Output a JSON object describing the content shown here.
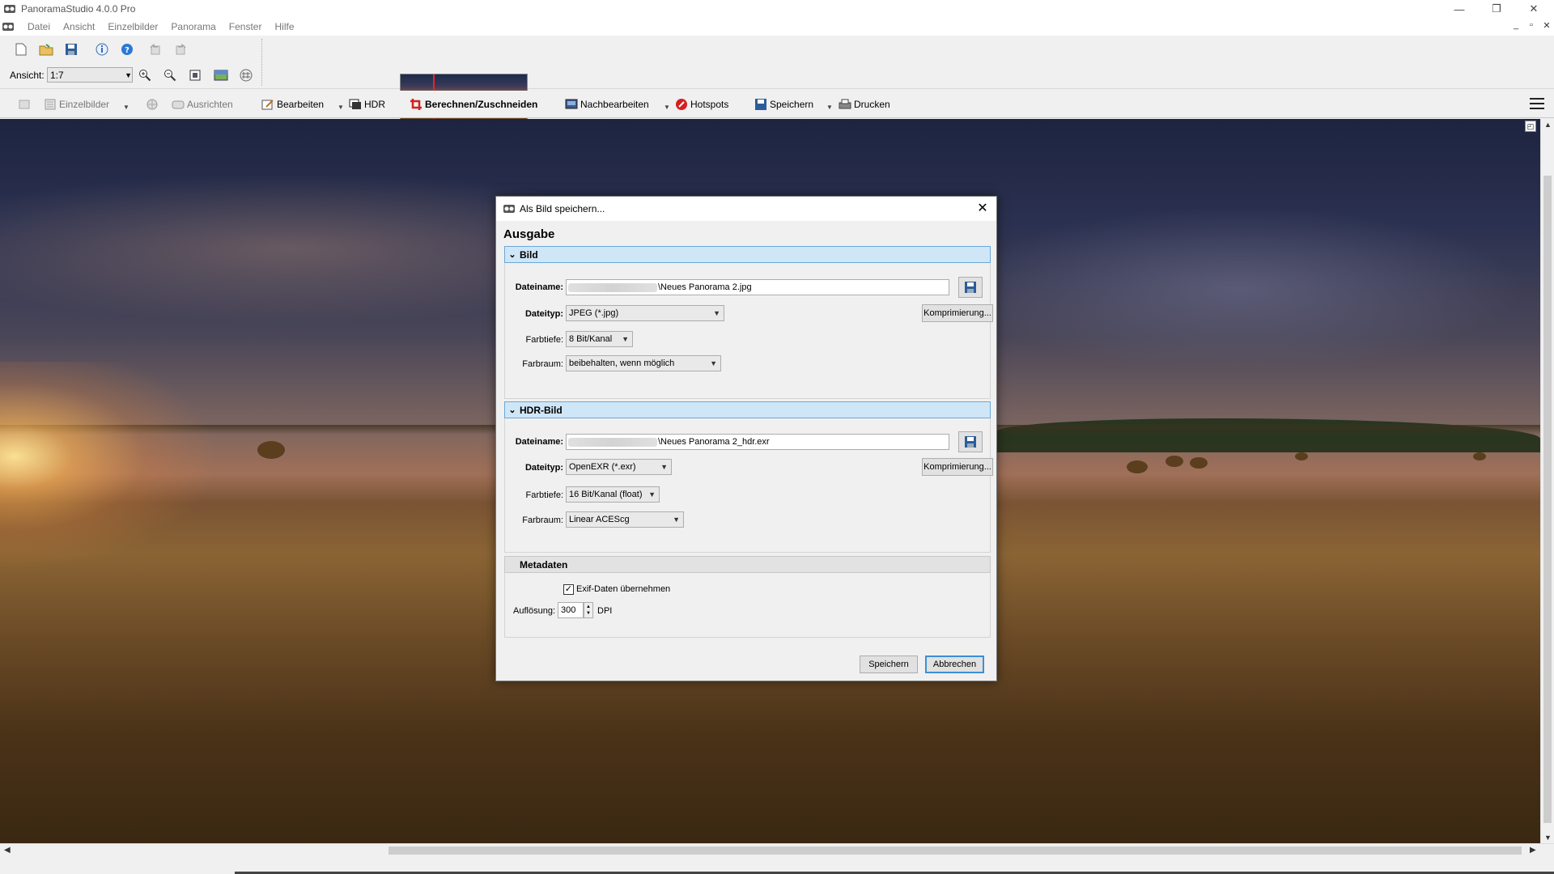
{
  "window": {
    "title": "PanoramaStudio 4.0.0 Pro",
    "controls": {
      "minimize": "—",
      "restore": "❐",
      "close": "✕"
    }
  },
  "menu": {
    "items": [
      "Datei",
      "Ansicht",
      "Einzelbilder",
      "Panorama",
      "Fenster",
      "Hilfe"
    ],
    "mdi": {
      "minimize": "_",
      "restore": "▫",
      "close": "✕"
    }
  },
  "toolbar": {
    "ansicht_label": "Ansicht:",
    "zoom_value": "1:7"
  },
  "workflow": {
    "items": [
      {
        "label": "Einzelbilder",
        "icon": "images-icon",
        "state": "disabled"
      },
      {
        "label": "Ausrichten",
        "icon": "align-icon",
        "state": "disabled"
      },
      {
        "label": "Bearbeiten",
        "icon": "edit-icon",
        "state": "normal"
      },
      {
        "label": "HDR",
        "icon": "hdr-icon",
        "state": "normal"
      },
      {
        "label": "Berechnen/Zuschneiden",
        "icon": "crop-icon",
        "state": "active"
      },
      {
        "label": "Nachbearbeiten",
        "icon": "postprocess-icon",
        "state": "normal"
      },
      {
        "label": "Hotspots",
        "icon": "hotspots-icon",
        "state": "normal"
      },
      {
        "label": "Speichern",
        "icon": "save-icon",
        "state": "normal"
      },
      {
        "label": "Drucken",
        "icon": "print-icon",
        "state": "normal"
      }
    ]
  },
  "dialog": {
    "title": "Als Bild speichern...",
    "heading": "Ausgabe",
    "bild": {
      "header": "Bild",
      "filename_label": "Dateiname:",
      "filename_value": "\\Neues Panorama 2.jpg",
      "filetype_label": "Dateityp:",
      "filetype_value": "JPEG (*.jpg)",
      "compression_button": "Komprimierung...",
      "colordepth_label": "Farbtiefe:",
      "colordepth_value": "8 Bit/Kanal",
      "colorspace_label": "Farbraum:",
      "colorspace_value": "beibehalten, wenn möglich"
    },
    "hdr": {
      "header": "HDR-Bild",
      "filename_label": "Dateiname:",
      "filename_value": "\\Neues Panorama 2_hdr.exr",
      "filetype_label": "Dateityp:",
      "filetype_value": "OpenEXR (*.exr)",
      "compression_button": "Komprimierung...",
      "colordepth_label": "Farbtiefe:",
      "colordepth_value": "16 Bit/Kanal (float)",
      "colorspace_label": "Farbraum:",
      "colorspace_value": "Linear ACEScg"
    },
    "metadata": {
      "header": "Metadaten",
      "exif_label": "Exif-Daten übernehmen",
      "exif_checked": true,
      "resolution_label": "Auflösung:",
      "resolution_value": "300",
      "resolution_unit": "DPI"
    },
    "buttons": {
      "save": "Speichern",
      "cancel": "Abbrechen"
    }
  },
  "colors": {
    "section_active_bg": "#cfe6f7",
    "section_active_border": "#6aa8d8",
    "default_button_border": "#3b8fd6",
    "active_tool_icon": "#d42020"
  }
}
